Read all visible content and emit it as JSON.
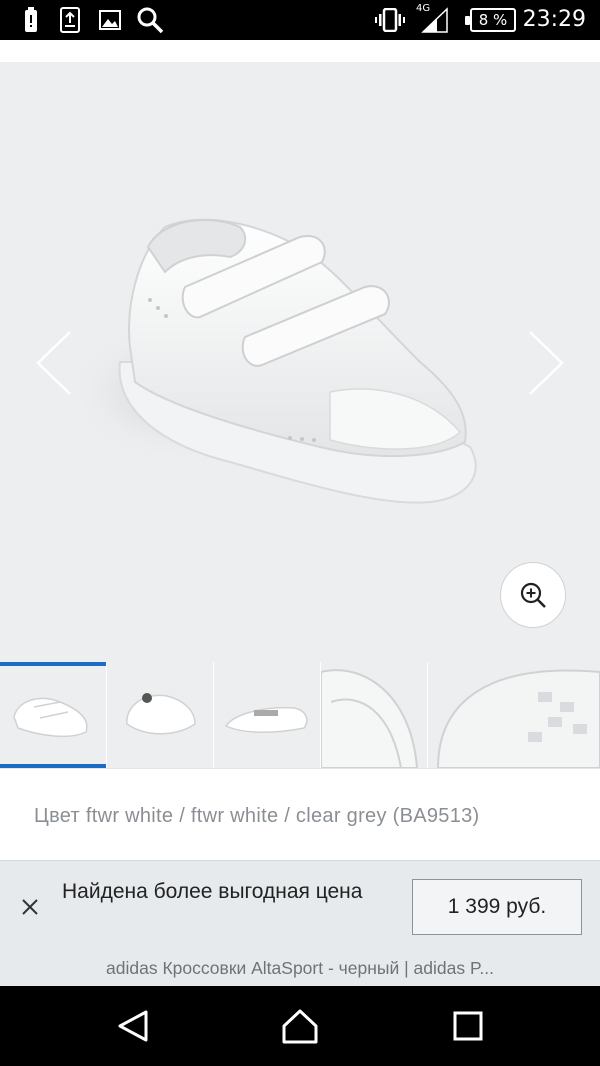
{
  "status_bar": {
    "time": "23:29",
    "battery": "8 %",
    "network": "4G",
    "icons": [
      "battery-saver-icon",
      "download-icon",
      "image-icon",
      "search-icon",
      "vibrate-icon",
      "signal-icon"
    ]
  },
  "product": {
    "color_line": "Цвет ftwr white / ftwr white / clear grey (BA9513)",
    "thumbnails": [
      "thumb-side-view",
      "thumb-back-view",
      "thumb-top-view",
      "thumb-detail-strap",
      "thumb-sole-view"
    ],
    "active_thumbnail": 0
  },
  "banner": {
    "text": "Найдена более выгодная цена",
    "price": "1 399 руб."
  },
  "page_title": "adidas Кроссовки AltaSport - черный | adidas P...",
  "colors": {
    "accent": "#1a6cc4",
    "image_bg": "#eceeef",
    "banner_bg": "#e7eaec"
  }
}
